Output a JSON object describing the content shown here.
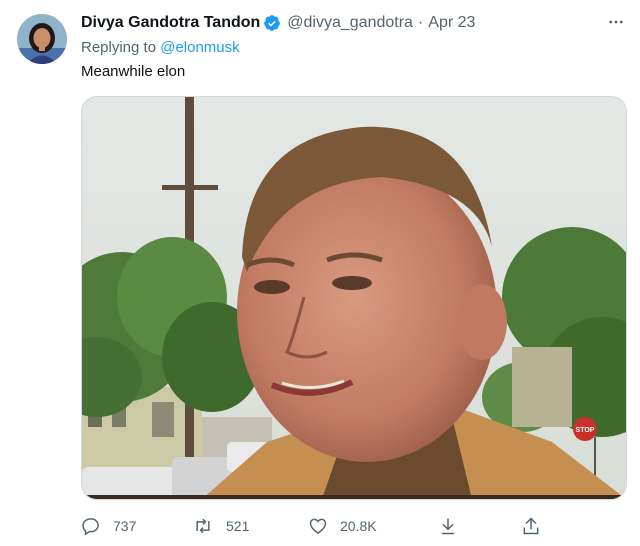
{
  "tweet": {
    "author_name": "Divya Gandotra Tandon",
    "author_handle": "@divya_gandotra",
    "separator": "·",
    "date": "Apr 23",
    "replying_prefix": "Replying to",
    "replying_to": "@elonmusk",
    "text": "Meanwhile elon",
    "verified": true,
    "media": {
      "icon": "photo",
      "sign_text": "STOP"
    }
  },
  "actions": {
    "reply_count": "737",
    "retweet_count": "521",
    "like_count": "20.8K"
  },
  "icons": {
    "more": "more-icon",
    "verified": "verified-badge-icon",
    "reply": "reply-icon",
    "retweet": "retweet-icon",
    "like": "like-icon",
    "download": "download-icon",
    "share": "share-icon"
  },
  "colors": {
    "text": "#0f1419",
    "secondary": "#536471",
    "accent": "#1d9bf0"
  }
}
